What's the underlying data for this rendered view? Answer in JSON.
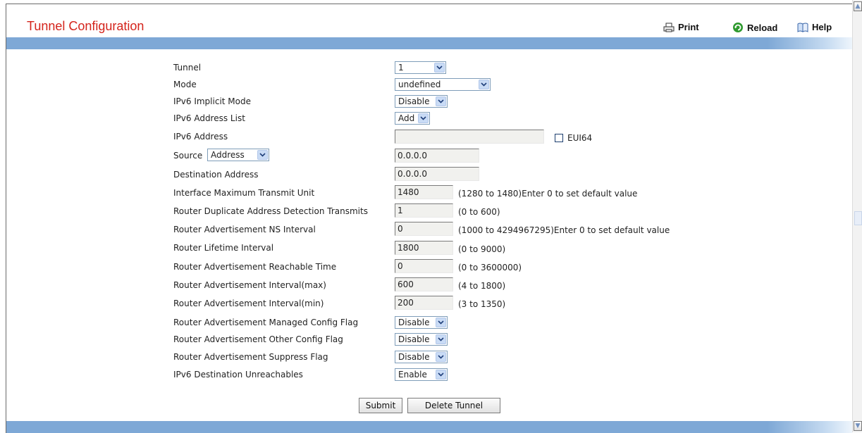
{
  "header": {
    "title": "Tunnel Configuration",
    "print_label": "Print",
    "reload_label": "Reload",
    "help_label": "Help"
  },
  "form": {
    "tunnel": {
      "label": "Tunnel",
      "value": "1"
    },
    "mode": {
      "label": "Mode",
      "value": "undefined"
    },
    "implicit_mode": {
      "label": "IPv6 Implicit Mode",
      "value": "Disable"
    },
    "address_list": {
      "label": "IPv6 Address List",
      "value": "Add"
    },
    "ipv6_address": {
      "label": "IPv6 Address",
      "value": "",
      "eui64_label": "EUI64"
    },
    "source": {
      "label": "Source",
      "type_value": "Address",
      "value": "0.0.0.0"
    },
    "destination": {
      "label": "Destination Address",
      "value": "0.0.0.0"
    },
    "mtu": {
      "label": "Interface Maximum Transmit Unit",
      "value": "1480",
      "hint": "(1280 to 1480)Enter 0 to set default value"
    },
    "dad": {
      "label": "Router Duplicate Address Detection Transmits",
      "value": "1",
      "hint": "(0 to 600)"
    },
    "ns_interval": {
      "label": "Router Advertisement NS Interval",
      "value": "0",
      "hint": "(1000 to 4294967295)Enter 0 to set default value"
    },
    "lifetime": {
      "label": "Router Lifetime Interval",
      "value": "1800",
      "hint": "(0 to 9000)"
    },
    "reachable": {
      "label": "Router Advertisement Reachable Time",
      "value": "0",
      "hint": "(0 to 3600000)"
    },
    "interval_max": {
      "label": "Router Advertisement Interval(max)",
      "value": "600",
      "hint": "(4 to 1800)"
    },
    "interval_min": {
      "label": "Router Advertisement Interval(min)",
      "value": "200",
      "hint": "(3 to 1350)"
    },
    "managed_flag": {
      "label": "Router Advertisement Managed Config Flag",
      "value": "Disable"
    },
    "other_flag": {
      "label": "Router Advertisement Other Config Flag",
      "value": "Disable"
    },
    "suppress_flag": {
      "label": "Router Advertisement Suppress Flag",
      "value": "Disable"
    },
    "unreachables": {
      "label": "IPv6 Destination Unreachables",
      "value": "Enable"
    }
  },
  "actions": {
    "submit": "Submit",
    "delete": "Delete Tunnel"
  },
  "colors": {
    "title": "#d4241c",
    "band": "#7ea8d6",
    "select_border": "#7f9db9",
    "arrow_bg": "#c9dbf5"
  }
}
